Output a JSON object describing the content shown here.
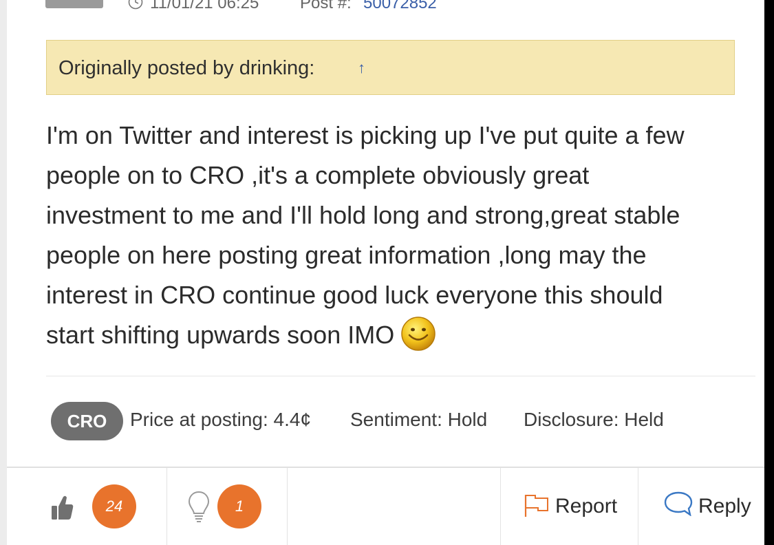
{
  "post": {
    "timestamp": "11/01/21 06:25",
    "post_number_label": "Post #:",
    "post_number": "50072852"
  },
  "quote": {
    "text": "Originally posted by drinking:",
    "arrow": "↑"
  },
  "body": {
    "lines": [
      "I'm on Twitter and interest is picking up I've put quite a few",
      "people on to CRO ,it's a complete obviously great",
      "investment to me and I'll hold long and strong,great stable",
      "people on here posting great information ,long may the",
      "interest in CRO continue good luck everyone this should",
      "start shifting upwards soon IMO"
    ],
    "emoji": "smiley-icon"
  },
  "tags": {
    "ticker": "CRO",
    "price": "Price at posting: 4.4¢",
    "sentiment": "Sentiment: Hold",
    "disclosure": "Disclosure: Held"
  },
  "actions": {
    "like_count": "24",
    "idea_count": "1",
    "report_label": "Report",
    "reply_label": "Reply"
  },
  "colors": {
    "quote_bg": "#f6e8b3",
    "badge": "#e8732c",
    "ticker_pill": "#6f6f6f",
    "link_blue": "#3a5fa8"
  }
}
